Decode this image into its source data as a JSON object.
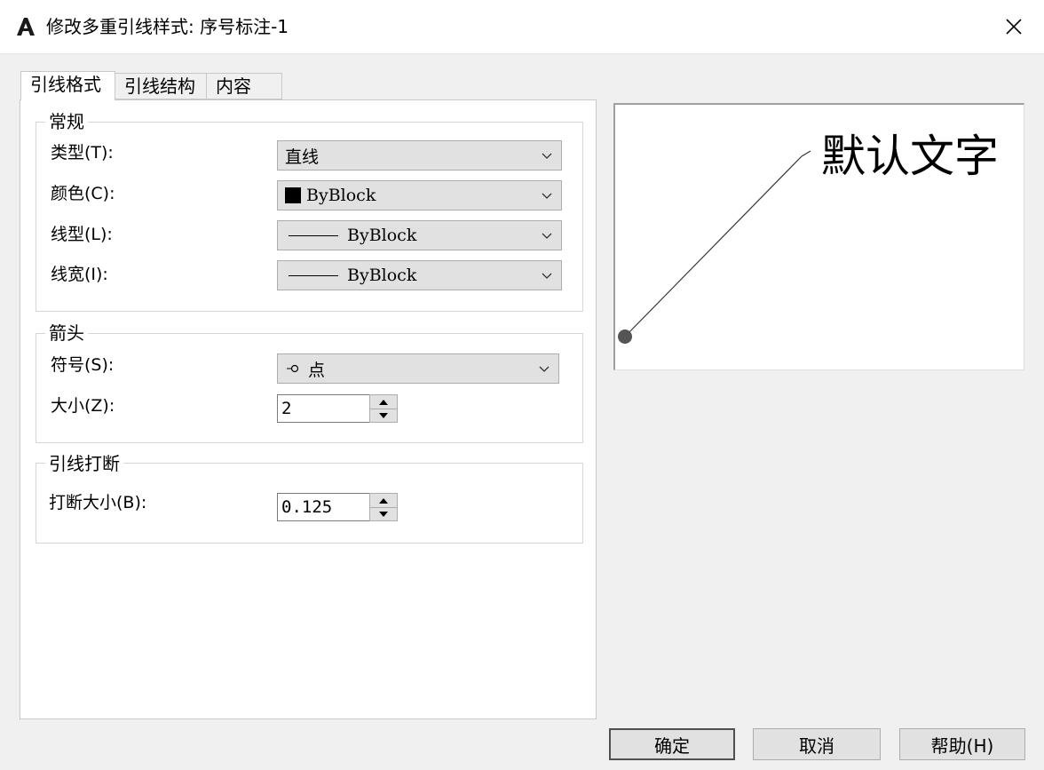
{
  "window": {
    "app_icon": "autocad-a-icon",
    "title": "修改多重引线样式: 序号标注-1",
    "close_icon": "close-icon"
  },
  "tabs": [
    {
      "label": "引线格式",
      "active": true
    },
    {
      "label": "引线结构",
      "active": false
    },
    {
      "label": "内容",
      "active": false
    }
  ],
  "general": {
    "title": "常规",
    "type_label": "类型(T):",
    "type_value": "直线",
    "color_label": "颜色(C):",
    "color_value": "ByBlock",
    "color_swatch": "#000000",
    "linetype_label": "线型(L):",
    "linetype_value": "ByBlock",
    "lineweight_label": "线宽(I):",
    "lineweight_value": "ByBlock"
  },
  "arrowhead": {
    "title": "箭头",
    "symbol_label": "符号(S):",
    "symbol_value": "点",
    "symbol_icon": "dot-arrowhead-icon",
    "size_label": "大小(Z):",
    "size_value": "2"
  },
  "leader_break": {
    "title": "引线打断",
    "break_size_label": "打断大小(B):",
    "break_size_value": "0.125"
  },
  "preview": {
    "text": "默认文字"
  },
  "buttons": {
    "ok": "确定",
    "cancel": "取消",
    "help": "帮助(H)"
  }
}
